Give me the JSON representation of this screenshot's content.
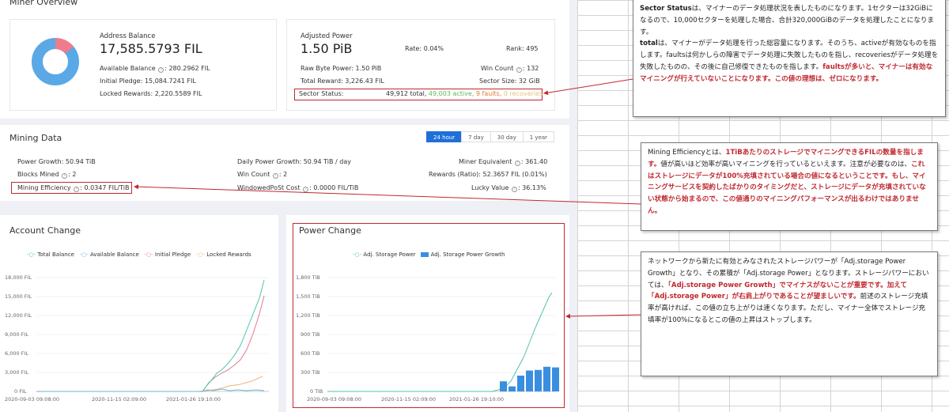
{
  "overview": {
    "title": "Miner Overview",
    "address_balance_label": "Address Balance",
    "address_balance_value": "17,585.5793 FIL",
    "available_balance": "Available Balance",
    "available_balance_value": ": 280.2962 FIL",
    "initial_pledge": "Initial Pledge: 15,084.7241 FIL",
    "locked_rewards": "Locked Rewards: 2,220.5589 FIL",
    "adjusted_power_label": "Adjusted Power",
    "adjusted_power_value": "1.50 PiB",
    "rate": "Rate: 0.04%",
    "rank": "Rank: 495",
    "raw_byte_power": "Raw Byte Power: 1.50 PiB",
    "win_count": "Win Count",
    "win_count_value": ": 132",
    "total_reward": "Total Reward: 3,226.43 FIL",
    "sector_size": "Sector Size: 32 GiB",
    "sector_status_label": "Sector Status:",
    "sector_total": "49,912 total,",
    "sector_active": "49,003 active,",
    "sector_faults": "9 faults,",
    "sector_recoveries": "0 recoveries",
    "donut": {
      "pledge_fraction": 0.14,
      "colors": [
        "#f07b8c",
        "#5aa9e6"
      ]
    }
  },
  "mining": {
    "title": "Mining Data",
    "tabs": [
      "24 hour",
      "7 day",
      "30 day",
      "1 year"
    ],
    "power_growth": "Power Growth: 50.94 TiB",
    "daily_power_growth": "Daily Power Growth: 50.94 TiB / day",
    "miner_equivalent": "Miner Equivalent",
    "miner_equivalent_value": ": 361.40",
    "blocks_mined": "Blocks Mined",
    "blocks_mined_value": ": 2",
    "win_count": "Win Count",
    "win_count_value": ": 2",
    "rewards": "Rewards (Ratio): 52.3657 FIL (0.01%)",
    "mining_efficiency": "Mining Efficiency",
    "mining_efficiency_value": ": 0.0347 FIL/TiB",
    "windowed_post": "WindowedPoSt Cost",
    "windowed_post_value": ": 0.0000 FIL/TiB",
    "lucky_value": "Lucky Value",
    "lucky_value_value": ": 36.13%"
  },
  "account_change": {
    "title": "Account Change",
    "legend": [
      "Total Balance",
      "Available Balance",
      "Initial Pledge",
      "Locked Rewards"
    ],
    "legend_colors": [
      "#4fc3b0",
      "#6fb2d8",
      "#e07a8a",
      "#f2b47a"
    ],
    "yticks": [
      "18,000 FIL",
      "15,000 FIL",
      "12,000 FIL",
      "9,000 FIL",
      "6,000 FIL",
      "3,000 FIL",
      "0 FIL"
    ],
    "xticks": [
      "2020-09-03 09:08:00",
      "2020-11-15 02:09:00",
      "2021-01-26 19:10:00"
    ]
  },
  "power_change": {
    "title": "Power Change",
    "legend": [
      "Adj. Storage Power",
      "Adj. Storage Power Growth"
    ],
    "legend_colors": [
      "#4fc3b0",
      "#3a8ee0"
    ],
    "yticks": [
      "1,800 TiB",
      "1,500 TiB",
      "1,200 TiB",
      "900 TiB",
      "600 TiB",
      "300 TiB",
      "0 TiB"
    ],
    "xticks": [
      "2020-09-03 09:08:00",
      "2020-11-15 02:09:00",
      "2021-01-26 19:10:00"
    ],
    "bar_values": [
      160,
      80,
      250,
      330,
      340,
      390,
      380
    ]
  },
  "notes": {
    "sector": {
      "p1a": "Sector Status",
      "p1b": "は、マイナーのデータ処理状況を表したものになります。1セクターは32GiBになるので、10,000セクターを処理した場合、合計320,000GiBのデータを処理したことになります。",
      "p2a": "total",
      "p2b": "は、マイナーがデータ処理を行った総容量になります。そのうち、active",
      "p2c": "が有効なものを指します。faults",
      "p2d": "は何かしらの障害でデータ処理に失敗したものを指し、recoveries",
      "p2e": "がデータ処理を失敗したものの、その後に自己修復できたものを指します。",
      "p2f": "faultsが多いと、マイナーは有効なマイニングが行えていないことになります。この値の理想は、ゼロになります。"
    },
    "efficiency": {
      "a": "Mining Efficiency",
      "b": "とは、",
      "c": "1TiBあたりのストレージでマイニングできるFILの数量を指します。",
      "d": "値が高いほど効率が高いマイニングを行っているといえます。注意が必要なのは、",
      "e": "これはストレージにデータが100%充填されている場合の値になるということです。もし、マイニングサービスを契約したばかりのタイミングだと、ストレージにデータが充填されていない状態から始まるので、この値通りのマイニングパフォーマンスが出るわけではありません。"
    },
    "power": {
      "a": "ネットワークから新たに有効とみなされたストレージパワーが「Adj.storage Power Growth」となり、その累積が「Adj.storage Power」となります。ストレージパワーにおいては、",
      "b": "「Adj.storage Power Growth」でマイナスがないことが重要です。加えて「Adj.storage Power」が右肩上がりであることが望ましいです。",
      "c": "前述のストレージ充填率が高ければ、この値の立ち上がりは速くなります。ただし、マイナー全体でストレージ充填率が100%になるとこの値の上昇はストップします。"
    }
  }
}
